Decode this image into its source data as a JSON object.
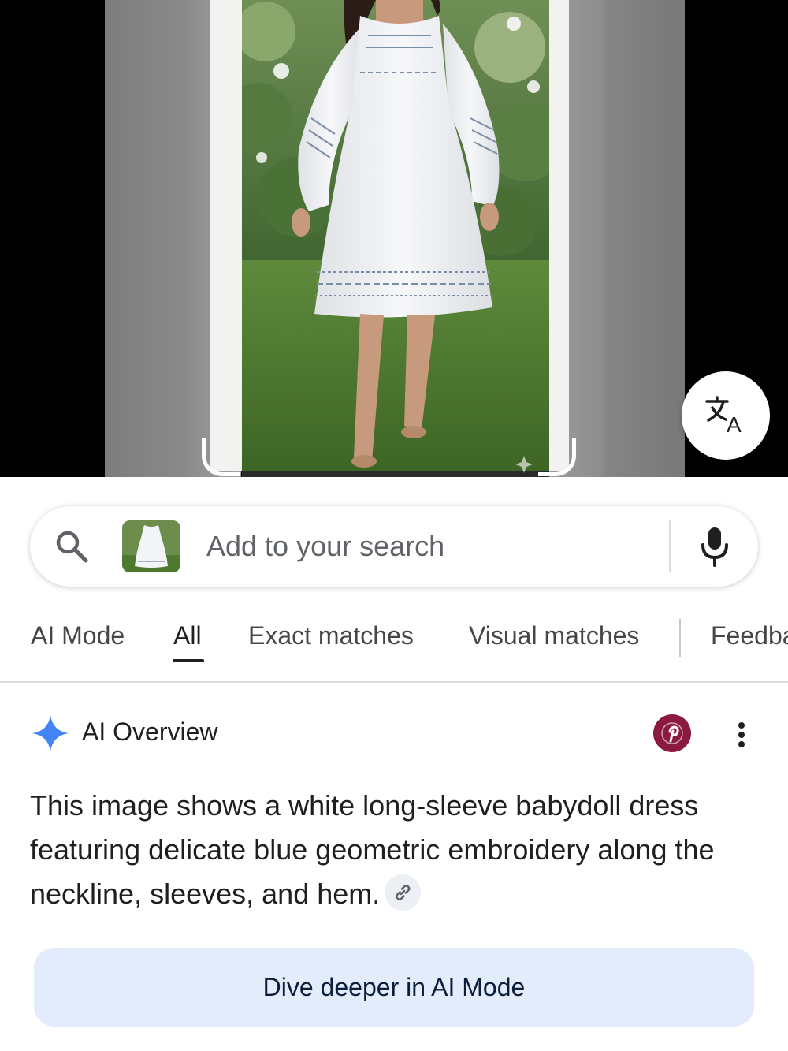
{
  "search": {
    "placeholder": "Add to your search"
  },
  "tabs": [
    {
      "label": "AI Mode"
    },
    {
      "label": "All"
    },
    {
      "label": "Exact matches"
    },
    {
      "label": "Visual matches"
    },
    {
      "label": "Feedba"
    }
  ],
  "active_tab": "All",
  "ai_overview": {
    "title": "AI Overview",
    "text": "This image shows a white long-sleeve babydoll dress featuring delicate blue geometric embroidery along the neckline, sleeves, and hem.",
    "source_favicon": "pinterest-icon",
    "dive_button_label": "Dive deeper in AI Mode"
  },
  "icons": {
    "search": "search-icon",
    "microphone": "microphone-icon",
    "translate": "translate-icon",
    "more": "more-vert-icon",
    "link": "link-icon",
    "gemini": "gemini-sparkle-icon"
  },
  "colors": {
    "accent_blue": "#4285f4",
    "dive_button_bg": "#e3ecfa",
    "dive_button_text": "#0b1e3b",
    "source_favicon_bg": "#8c1a3e"
  }
}
